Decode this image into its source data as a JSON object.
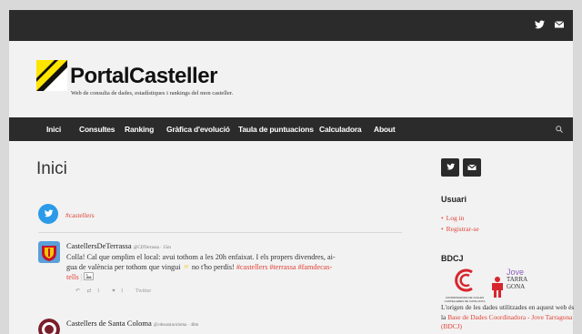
{
  "topbar": {
    "twitter_icon": "twitter-icon",
    "email_icon": "email-icon"
  },
  "header": {
    "title": "PortalCasteller",
    "tagline": "Web de consulta de dades, estadístiques i rankings del mon casteller."
  },
  "nav": {
    "items": [
      "Inici",
      "Consultes",
      "Ranking",
      "Gràfica d'evolució",
      "Taula de puntuacions",
      "Calculadora",
      "About"
    ],
    "search_icon": "search-icon"
  },
  "main": {
    "page_title": "Inici",
    "feed_hashtag": "#castellers",
    "tweets": [
      {
        "name": "CastellersDeTerrassa",
        "handle": "@CDTerrassa · 15m",
        "text_1": "Colla! Cal que omplim el local: avui tothom a les 20h enfaixat. I els propers divendres, ai-",
        "text_2a": "gua de valència per tothom que vingui ",
        "text_2b": " no t'ho perdis! ",
        "text_2c": "#castellers #terrassa #famdecas-",
        "text_3": "tells",
        "retweets": "1",
        "likes": "1",
        "source": "Twitter"
      },
      {
        "name": "Castellers de Santa Coloma",
        "handle": "@cdesantacoloma · 48m"
      }
    ]
  },
  "sidebar": {
    "usuari_heading": "Usuari",
    "login": "Log in",
    "register": "Registrar-se",
    "bdcj_heading": "BDCJ",
    "logo_left_text": "COORDINADORA DE COLLES CASTELLERES DE CATALUNYA",
    "logo_right_text": [
      "Jove",
      "TARRA",
      "GONA"
    ],
    "desc_1": "L'origen de les dades utilitzades en aquest web és la ",
    "desc_link": "Base de Dades Coordinadora - Jove Tarragona (BDCJ)"
  },
  "colors": {
    "accent": "#e04337",
    "dark": "#2b2b2b",
    "twitter": "#2b9ae8"
  }
}
